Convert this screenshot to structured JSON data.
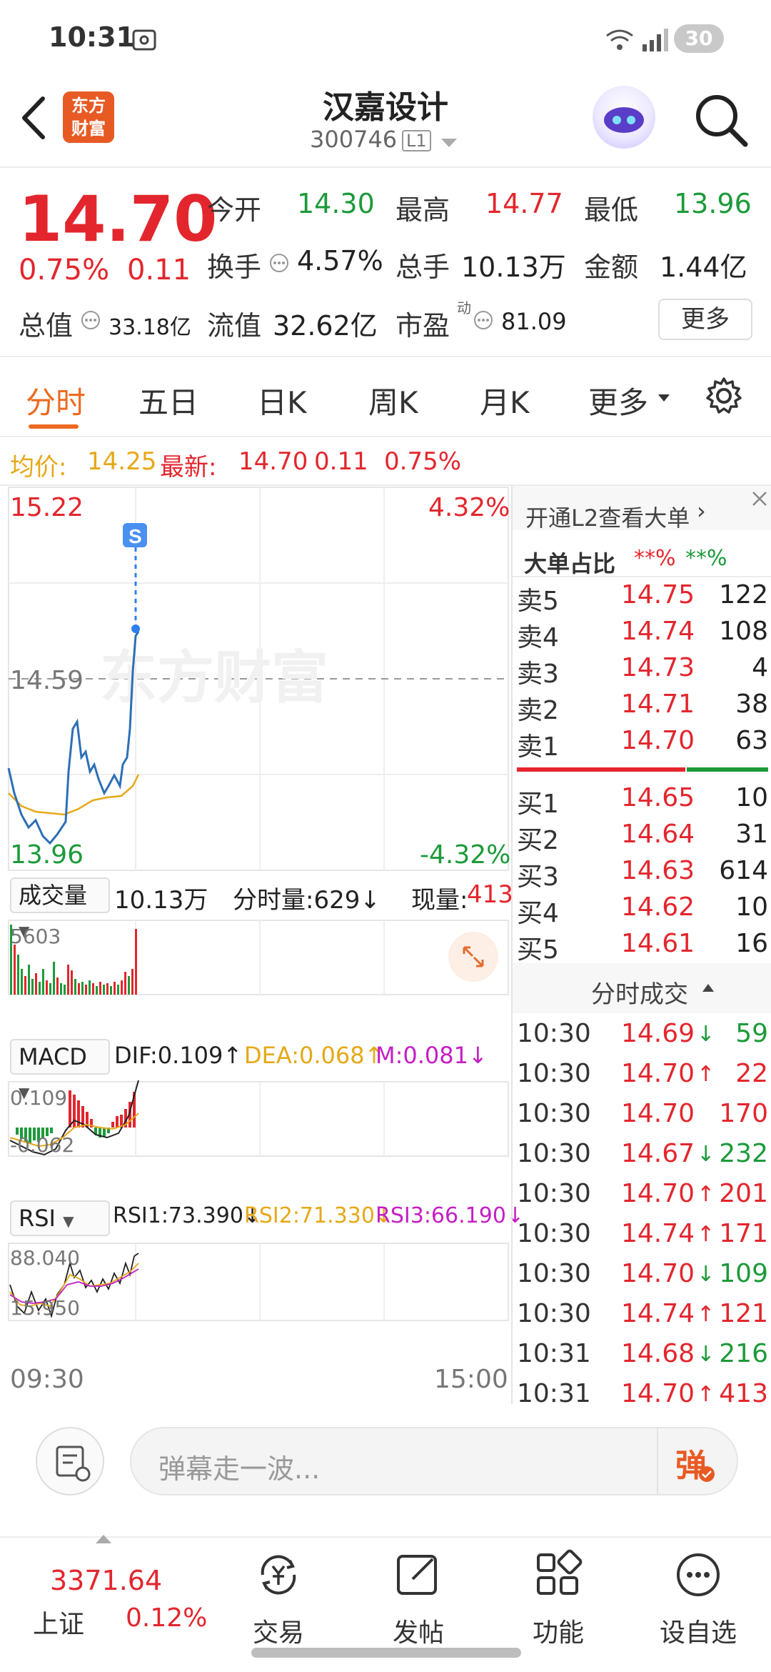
{
  "status": {
    "time": "10:31",
    "battery": "30"
  },
  "header": {
    "logo_line1": "东方",
    "logo_line2": "财富",
    "title": "汉嘉设计",
    "code": "300746",
    "level_badge": "L1"
  },
  "quote": {
    "price": "14.70",
    "change_pct": "0.75%",
    "change": "0.11",
    "open_label": "今开",
    "open": "14.30",
    "high_label": "最高",
    "high": "14.77",
    "low_label": "最低",
    "low": "13.96",
    "turnover_label": "换手",
    "turnover": "4.57%",
    "volume_label": "总手",
    "volume": "10.13万",
    "amount_label": "金额",
    "amount": "1.44亿",
    "mktcap_label": "总值",
    "mktcap": "33.18亿",
    "float_label": "流值",
    "float": "32.62亿",
    "pe_label": "市盈",
    "pe_sup": "动",
    "pe": "81.09",
    "more": "更多"
  },
  "tabs": [
    "分时",
    "五日",
    "日K",
    "周K",
    "月K",
    "更多"
  ],
  "avgbar": {
    "avg_label": "均价:",
    "avg": "14.25",
    "latest_label": "最新:",
    "latest": "14.70",
    "latest_chg": "0.11",
    "latest_pct": "0.75%"
  },
  "chart": {
    "y_top": "15.22",
    "y_mid": "14.59",
    "y_bot": "13.96",
    "pct_top": "4.32%",
    "pct_bot": "-4.32%",
    "marker": "S",
    "watermark": "东方财富",
    "vol_label": "成交量",
    "vol_total": "10.13万",
    "vol_min_label": "分时量:629↓",
    "vol_now_label": "现量:",
    "vol_now": "413",
    "vol_max": "5603",
    "macd_label": "MACD",
    "dif": "DIF:0.109↑",
    "dea": "DEA:0.068↑",
    "m": "M:0.081↓",
    "macd_top": "0.109",
    "macd_bot": "-0.062",
    "rsi_label": "RSI",
    "rsi1": "RSI1:73.390↓",
    "rsi2": "RSI2:71.330↓",
    "rsi3": "RSI3:66.190↓",
    "rsi_top": "88.040",
    "rsi_bot": "15.950",
    "time_start": "09:30",
    "time_end": "15:00"
  },
  "orderbook": {
    "promo": "开通L2查看大单",
    "big_label": "大单占比",
    "big_red": "**%",
    "big_green": "**%",
    "sells": [
      {
        "label": "卖5",
        "price": "14.75",
        "vol": "122"
      },
      {
        "label": "卖4",
        "price": "14.74",
        "vol": "108"
      },
      {
        "label": "卖3",
        "price": "14.73",
        "vol": "4"
      },
      {
        "label": "卖2",
        "price": "14.71",
        "vol": "38"
      },
      {
        "label": "卖1",
        "price": "14.70",
        "vol": "63"
      }
    ],
    "buys": [
      {
        "label": "买1",
        "price": "14.65",
        "vol": "10"
      },
      {
        "label": "买2",
        "price": "14.64",
        "vol": "31"
      },
      {
        "label": "买3",
        "price": "14.63",
        "vol": "614"
      },
      {
        "label": "买4",
        "price": "14.62",
        "vol": "10"
      },
      {
        "label": "买5",
        "price": "14.61",
        "vol": "16"
      }
    ],
    "ticks_label": "分时成交",
    "ticks": [
      {
        "time": "10:30",
        "price": "14.69",
        "dir": "↓",
        "vol": "59",
        "color": "green"
      },
      {
        "time": "10:30",
        "price": "14.70",
        "dir": "↑",
        "vol": "22",
        "color": "red"
      },
      {
        "time": "10:30",
        "price": "14.70",
        "dir": "",
        "vol": "170",
        "color": "red"
      },
      {
        "time": "10:30",
        "price": "14.67",
        "dir": "↓",
        "vol": "232",
        "color": "green"
      },
      {
        "time": "10:30",
        "price": "14.70",
        "dir": "↑",
        "vol": "201",
        "color": "red"
      },
      {
        "time": "10:30",
        "price": "14.74",
        "dir": "↑",
        "vol": "171",
        "color": "red"
      },
      {
        "time": "10:30",
        "price": "14.70",
        "dir": "↓",
        "vol": "109",
        "color": "green"
      },
      {
        "time": "10:30",
        "price": "14.74",
        "dir": "↑",
        "vol": "121",
        "color": "red"
      },
      {
        "time": "10:31",
        "price": "14.68",
        "dir": "↓",
        "vol": "216",
        "color": "green"
      },
      {
        "time": "10:31",
        "price": "14.70",
        "dir": "↑",
        "vol": "413",
        "color": "red"
      }
    ]
  },
  "comment": {
    "placeholder": "弹幕走一波...",
    "danmu_btn": "弹"
  },
  "bottomnav": {
    "index_value": "3371.64",
    "index_name": "上证",
    "index_pct": "0.12%",
    "items": [
      "交易",
      "发帖",
      "功能",
      "设自选"
    ]
  },
  "colors": {
    "up": "#e3262d",
    "down": "#1c9a3a",
    "avg": "#e6a817",
    "accent": "#ec6a1f",
    "price_line": "#2d6fb5"
  }
}
